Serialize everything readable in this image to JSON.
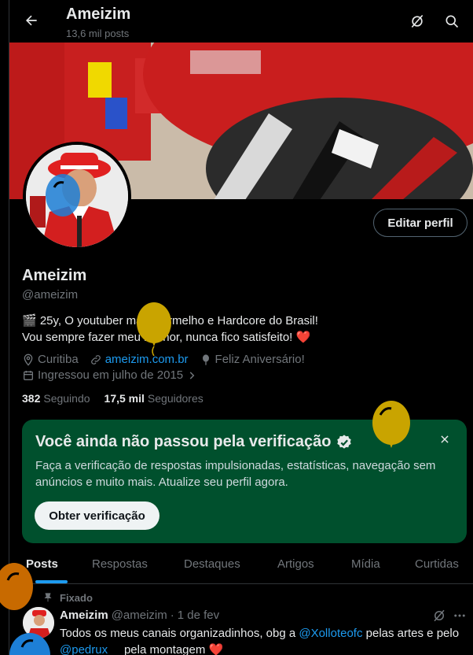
{
  "header": {
    "title": "Ameizim",
    "subtitle": "13,6 mil posts"
  },
  "profile": {
    "edit_label": "Editar perfil",
    "name": "Ameizim",
    "handle": "@ameizim",
    "bio_line1": "🎬 25y, O youtuber mais Vermelho e Hardcore do Brasil!",
    "bio_line2": "Vou sempre fazer meu melhor, nunca fico satisfeito! ❤️",
    "location": "Curitiba",
    "website": "ameizim.com.br",
    "birthday": "Feliz Aniversário!",
    "joined": "Ingressou em julho de 2015",
    "following_count": "382",
    "following_label": "Seguindo",
    "followers_count": "17,5 mil",
    "followers_label": "Seguidores"
  },
  "verification": {
    "title": "Você ainda não passou pela verificação",
    "description": "Faça a verificação de respostas impulsionadas, estatísticas, navegação sem anúncios e muito mais. Atualize seu perfil agora.",
    "button": "Obter verificação"
  },
  "tabs": [
    {
      "label": "Posts"
    },
    {
      "label": "Respostas"
    },
    {
      "label": "Destaques"
    },
    {
      "label": "Artigos"
    },
    {
      "label": "Mídia"
    },
    {
      "label": "Curtidas"
    }
  ],
  "pinned_tweet": {
    "pinned_label": "Fixado",
    "name": "Ameizim",
    "handle": "@ameizim",
    "separator": "·",
    "date": "1 de fev",
    "text_part1": "Todos os meus canais organizadinhos, obg a ",
    "mention1": "@Xolloteofc",
    "text_part2": " pelas artes e pelo ",
    "mention2": "@pedrux__",
    "text_part3": "  pela montagem ",
    "emoji": "❤️"
  },
  "colors": {
    "accent": "#1d9bf0",
    "verify_bg": "#00502d",
    "balloon_yellow": "#c9a400",
    "balloon_orange": "#c86a00",
    "balloon_blue": "#1d7fd6"
  }
}
